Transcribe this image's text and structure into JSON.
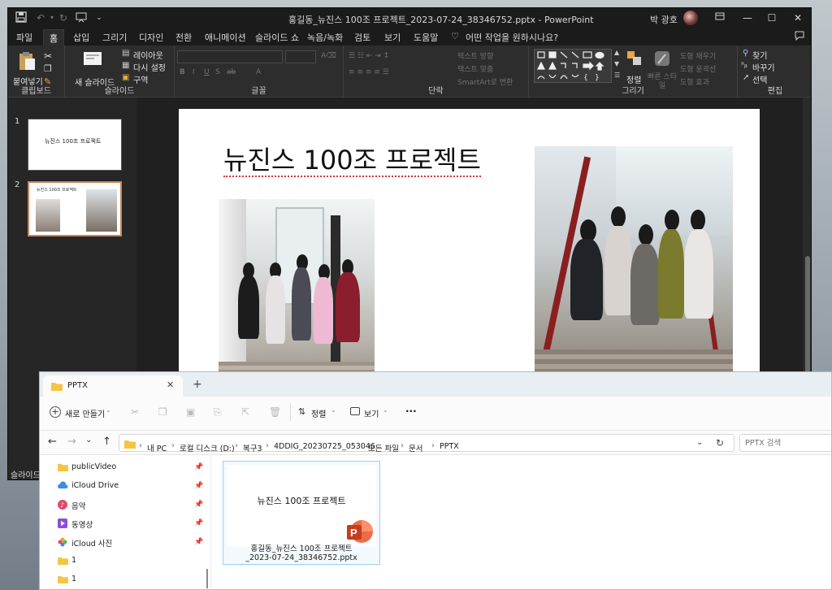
{
  "powerpoint": {
    "title": "홍길동_뉴진스 100조 프로젝트_2023-07-24_38346752.pptx  -  PowerPoint",
    "user": "박 광호",
    "tabs": [
      "파일",
      "홈",
      "삽입",
      "그리기",
      "디자인",
      "전환",
      "애니메이션",
      "슬라이드 쇼",
      "녹음/녹화",
      "검토",
      "보기",
      "도움말"
    ],
    "active_tab": "홈",
    "tell_me": "어떤 작업을 원하시나요?",
    "ribbon": {
      "paste": "붙여넣기",
      "clipboard": "클립보드",
      "new_slide": "새 슬라이드",
      "layout": "레이아웃",
      "reset": "다시 설정",
      "section": "구역",
      "slides": "슬라이드",
      "font": "글꼴",
      "paragraph": "단락",
      "text_direction": "텍스트 방향",
      "align_text": "텍스트 맞춤",
      "smartart": "SmartArt로 변환",
      "arrange": "정렬",
      "quick_styles": "빠른 스타일",
      "shape_fill": "도형 채우기",
      "shape_outline": "도형 윤곽선",
      "shape_effects": "도형 효과",
      "drawing": "그리기",
      "find": "찾기",
      "replace": "바꾸기",
      "select": "선택",
      "editing": "편집"
    },
    "thumbnails": [
      {
        "number": "1",
        "text": "뉴진스 100조 프로젝트"
      },
      {
        "number": "2",
        "text": "뉴진스 100조 프로젝트"
      }
    ],
    "slide_title": "뉴진스 100조 프로젝트",
    "status": "슬라이드"
  },
  "explorer": {
    "tab_title": "PPTX",
    "new_tab_symbol": "+",
    "new_button": "새로 만들기",
    "sort": "정렬",
    "view": "보기",
    "more": "···",
    "breadcrumb": [
      "내 PC",
      "로컬 디스크 (D:)",
      "복구3",
      "4DDIG_20230725_053046",
      "모든 파일",
      "문서",
      "PPTX"
    ],
    "search_placeholder": "PPTX 검색",
    "nav": [
      {
        "label": "publicVideo",
        "icon": "folder-icon",
        "pinned": true
      },
      {
        "label": "iCloud Drive",
        "icon": "cloud-icon",
        "pinned": true
      },
      {
        "label": "음악",
        "icon": "music-icon",
        "pinned": true
      },
      {
        "label": "동영상",
        "icon": "video-icon",
        "pinned": true
      },
      {
        "label": "iCloud 사진",
        "icon": "photos-icon",
        "pinned": true
      },
      {
        "label": "1",
        "icon": "folder-icon",
        "pinned": false
      },
      {
        "label": "1",
        "icon": "folder-icon",
        "pinned": false
      }
    ],
    "file": {
      "thumbnail_text": "뉴진스 100조 프로젝트",
      "name_line1": "홍길동_뉴진스 100조 프로젝트",
      "name_line2": "_2023-07-24_38346752.pptx"
    }
  },
  "colors": {
    "ppt_dark": "#262626",
    "ppt_accent": "#c43e1c",
    "selection": "#c8875a",
    "folder": "#f4c542",
    "explorer_select": "#99d1ee"
  }
}
